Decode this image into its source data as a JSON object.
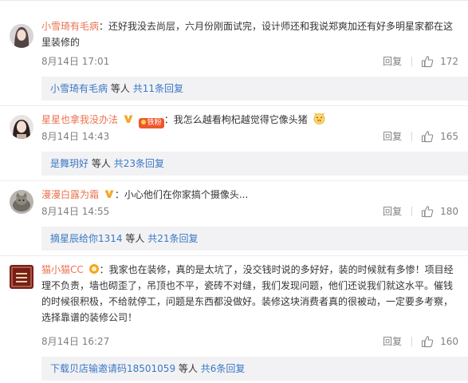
{
  "comments": [
    {
      "user": "小雪琦有毛病",
      "text_lines": [
        "：还好我没去尚层，六月份刚面试完，设计师还和我说郑爽加还有好多明星家都在这",
        "里装修的"
      ],
      "time": "8月14日 17:01",
      "reply_label": "回复",
      "likes": "172",
      "sub_user": "小雪琦有毛病",
      "sub_etc": "等人",
      "sub_count": "共11条回复"
    },
    {
      "user": "星星也拿我没办法",
      "badge_text": "铁粉",
      "text_lines": [
        "：我怎么越看枸杞越觉得它像头猪"
      ],
      "time": "8月14日 14:43",
      "reply_label": "回复",
      "likes": "165",
      "sub_user": "是舞玥好",
      "sub_etc": "等人",
      "sub_count": "共23条回复"
    },
    {
      "user": "漫漫白露为霜",
      "text_lines": [
        "：小心他们在你家搞个摄像头..."
      ],
      "time": "8月14日 14:55",
      "reply_label": "回复",
      "likes": "180",
      "sub_user": "摘星辰给你1314",
      "sub_etc": "等人",
      "sub_count": "共21条回复"
    },
    {
      "user": "猫小猫CC",
      "text_lines": [
        "：我家也在装修，真的是太坑了，没交钱时说的多好好，装的时候就有多惨！项目经",
        "理不负责，墙也砌歪了，吊顶也不平，瓷砖不对缝，我们发现问题，他们还说我们就这水平。催钱",
        "的时候很积极，不给就停工，问题是东西都没做好。装修这块消费者真的很被动，一定要多考察，",
        "选择靠谱的装修公司！"
      ],
      "time": "8月14日 16:27",
      "reply_label": "回复",
      "likes": "160",
      "sub_user": "下载贝店输邀请码18501059",
      "sub_etc": "等人",
      "sub_count": "共6条回复"
    }
  ],
  "colors": {
    "username": "#eb7350",
    "sublink": "#3a78c3",
    "meta": "#808080",
    "subbox_bg": "#f2f2f5"
  },
  "icons": {
    "verified": "v-badge-icon",
    "like": "thumbs-up-icon",
    "fan": "fan-badge-icon",
    "pig": "pig-emoji-icon"
  }
}
